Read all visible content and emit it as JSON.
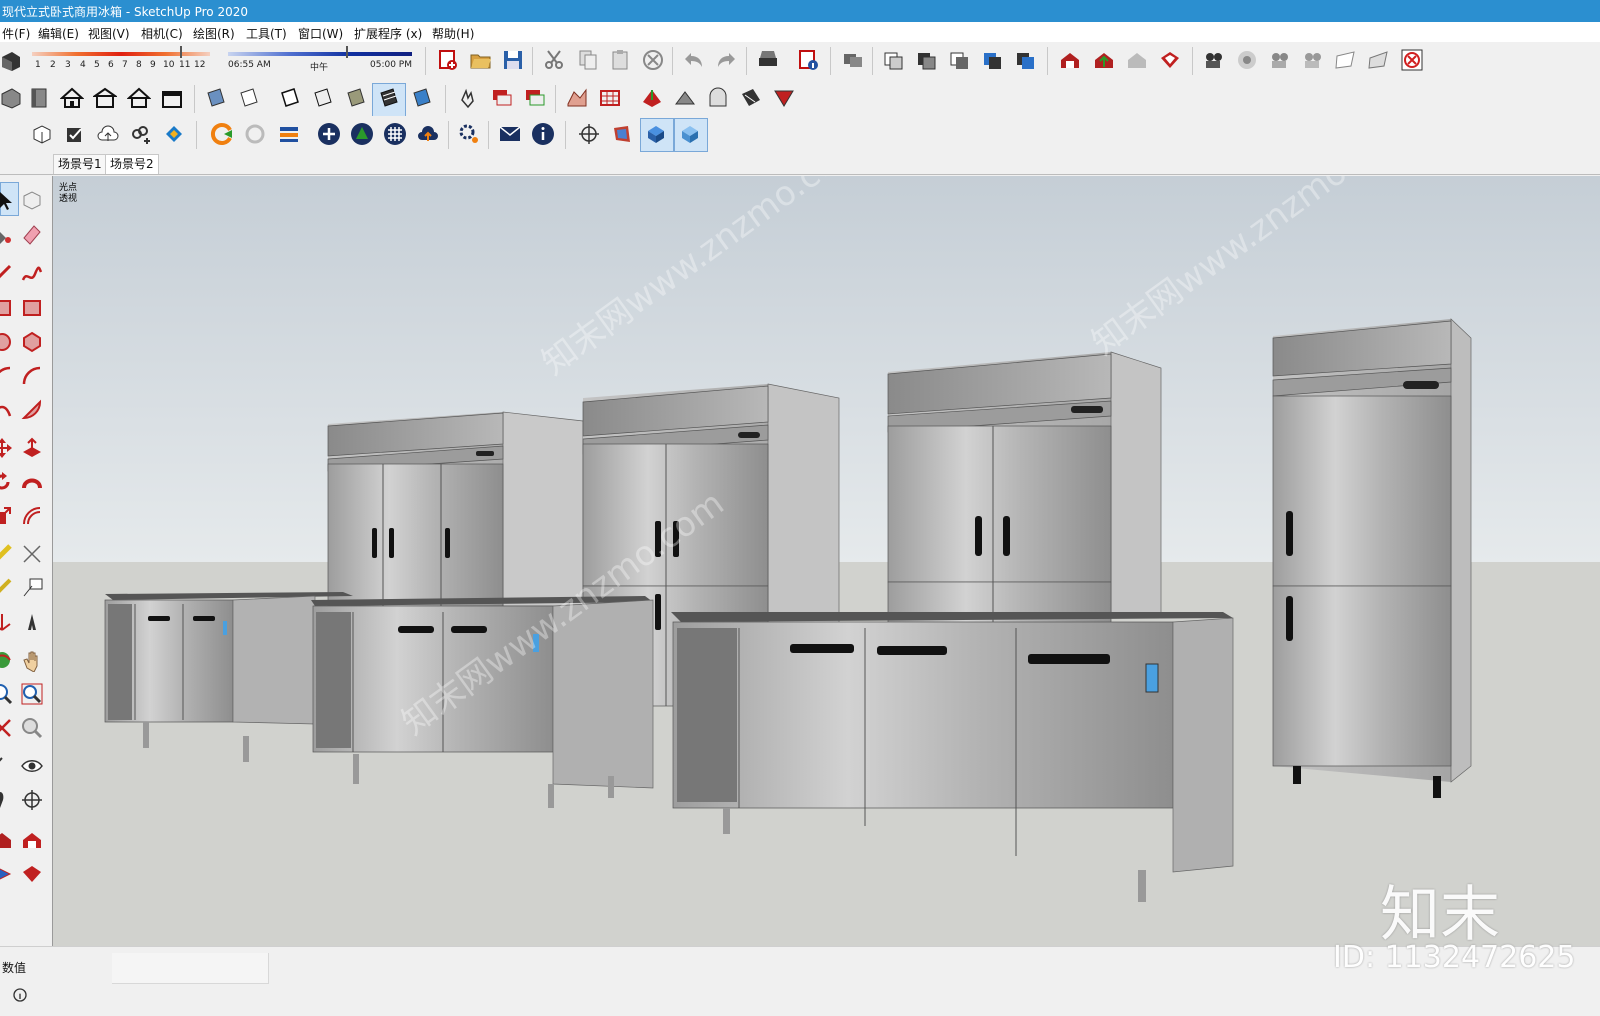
{
  "window": {
    "title": "现代立式卧式商用冰箱 - SketchUp Pro 2020"
  },
  "menu": [
    {
      "id": "file",
      "label": "件(F)"
    },
    {
      "id": "edit",
      "label": "编辑(E)"
    },
    {
      "id": "view",
      "label": "视图(V)"
    },
    {
      "id": "camera",
      "label": "相机(C)"
    },
    {
      "id": "draw",
      "label": "绘图(R)"
    },
    {
      "id": "tools",
      "label": "工具(T)"
    },
    {
      "id": "window",
      "label": "窗口(W)"
    },
    {
      "id": "extensions",
      "label": "扩展程序 (x)"
    },
    {
      "id": "help",
      "label": "帮助(H)"
    }
  ],
  "shadow": {
    "months": [
      "1",
      "2",
      "3",
      "4",
      "5",
      "6",
      "7",
      "8",
      "9",
      "10",
      "11",
      "12"
    ],
    "time_start": "06:55 AM",
    "time_mid": "中午",
    "time_end": "05:00 PM"
  },
  "scene_tabs": [
    {
      "label": "场景号1",
      "active": false
    },
    {
      "label": "场景号2",
      "active": true
    }
  ],
  "viewport": {
    "camera_line1": "光点",
    "camera_line2": "透视",
    "watermark": "知末网www.znzmo.com"
  },
  "status": {
    "measurements_label": "数值",
    "brand_mark": "知末",
    "id_label": "ID: 1132472625"
  },
  "colors": {
    "title_bar": "#2b8fd0",
    "sky_top": "#c7cfd6",
    "ground": "#d1d2ce",
    "steel": "#b8b8b8"
  }
}
